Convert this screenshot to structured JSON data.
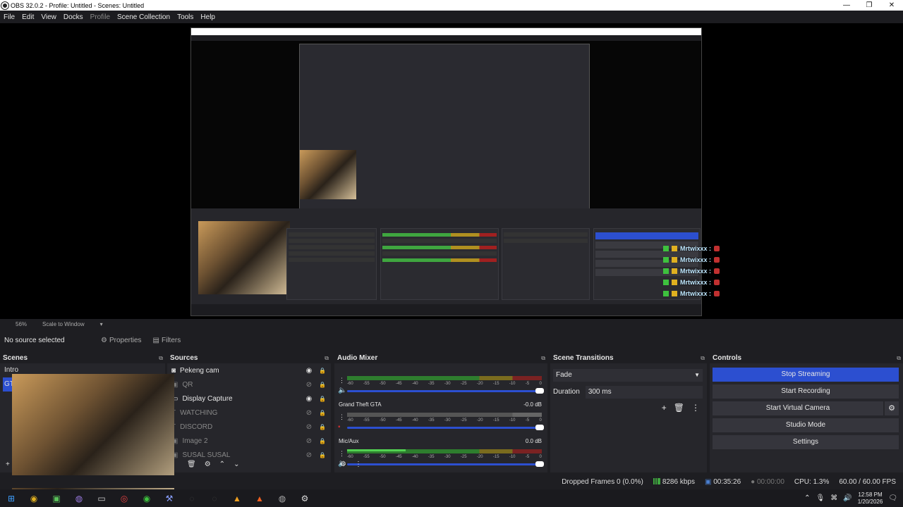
{
  "window": {
    "title": "OBS 32.0.2 - Profile: Untitled - Scenes: Untitled",
    "controls": [
      "—",
      "❐",
      "✕"
    ]
  },
  "menu": [
    "File",
    "Edit",
    "View",
    "Docks",
    "Profile",
    "Scene Collection",
    "Tools",
    "Help"
  ],
  "chat": {
    "lines": [
      "Mrtwixxx :",
      "Mrtwixxx :",
      "Mrtwixxx :",
      "Mrtwixxx :",
      "Mrtwixxx :"
    ]
  },
  "zoom": {
    "level": "56%",
    "mode": "Scale to Window"
  },
  "properties_bar": {
    "no_source": "No source selected",
    "properties": "Properties",
    "filters": "Filters"
  },
  "scenes": {
    "title": "Scenes",
    "items": [
      "Intro",
      "GT"
    ],
    "selected": 1
  },
  "sources": {
    "title": "Sources",
    "items": [
      {
        "label": "Pekeng cam",
        "icon": "camera-icon",
        "visible": true
      },
      {
        "label": "QR",
        "icon": "image-icon",
        "visible": false
      },
      {
        "label": "Display Capture",
        "icon": "monitor-icon",
        "visible": true
      },
      {
        "label": "WATCHING",
        "icon": "text-icon",
        "visible": false
      },
      {
        "label": "DISCORD",
        "icon": "text-icon",
        "visible": false
      },
      {
        "label": "Image 2",
        "icon": "image-icon",
        "visible": false
      },
      {
        "label": "SUSAL SUSAL",
        "icon": "image-icon",
        "visible": false
      }
    ]
  },
  "audio_mixer": {
    "title": "Audio Mixer",
    "ticks": [
      "-60",
      "-55",
      "-50",
      "-45",
      "-40",
      "-35",
      "-30",
      "-25",
      "-20",
      "-15",
      "-10",
      "-5",
      "0"
    ],
    "channels": [
      {
        "name": "",
        "db": "",
        "level": 0.0,
        "active": true
      },
      {
        "name": "Grand Theft GTA",
        "db": "-0.0 dB",
        "level": 0.0,
        "active": false
      },
      {
        "name": "Mic/Aux",
        "db": "0.0 dB",
        "level": 0.3,
        "active": true
      }
    ]
  },
  "scene_transitions": {
    "title": "Scene Transitions",
    "transition": "Fade",
    "duration_label": "Duration",
    "duration_value": "300 ms"
  },
  "controls": {
    "title": "Controls",
    "buttons": [
      "Stop Streaming",
      "Start Recording",
      "Start Virtual Camera",
      "Studio Mode",
      "Settings"
    ]
  },
  "status": {
    "dropped": "Dropped Frames 0 (0.0%)",
    "bitrate": "8286 kbps",
    "stream_time": "00:35:26",
    "rec_time": "00:00:00",
    "cpu": "CPU: 1.3%",
    "fps": "60.00 / 60.00 FPS"
  },
  "taskbar": {
    "time": "12:58 PM",
    "date": "1/20/2026"
  },
  "colors": {
    "accent": "#2c4fd0",
    "background": "#1e1e22",
    "panel": "#26262b"
  }
}
